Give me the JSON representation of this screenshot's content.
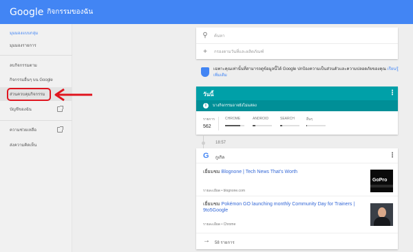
{
  "app": {
    "logo": "Google",
    "title": "กิจกรรมของฉัน"
  },
  "sidebar": {
    "items": [
      {
        "label": "มุมมองแบบกลุ่ม"
      },
      {
        "label": "มุมมองรายการ"
      },
      {
        "label": "ลบกิจกรรมตาม"
      },
      {
        "label": "กิจกรรมอื่นๆ บน Google"
      },
      {
        "label": "ส่วนควบคุมกิจกรรม"
      },
      {
        "label": "บัญชีของฉัน"
      },
      {
        "label": "ความช่วยเหลือ"
      },
      {
        "label": "ส่งความคิดเห็น"
      }
    ]
  },
  "search": {
    "placeholder": "ค้นหา",
    "filter_label": "กรองตามวันที่และผลิตภัณฑ์"
  },
  "privacy": {
    "text": "เฉพาะคุณเท่านั้นที่สามารถดูข้อมูลนี้ได้ Google ปกป้องความเป็นส่วนตัวและความปลอดภัยของคุณ",
    "link": "เรียนรู้เพิ่มเติม"
  },
  "today": {
    "title": "วันนี้",
    "notice": "บางกิจกรรมอาจยังไม่แสดง",
    "total_label": "รายการ",
    "total_value": "562",
    "stats": [
      {
        "label": "CHROME",
        "fill": 0.8
      },
      {
        "label": "ANDROID",
        "fill": 0.15
      },
      {
        "label": "SEARCH",
        "fill": 0.1
      },
      {
        "label": "อื่นๆ",
        "fill": 0.05
      }
    ]
  },
  "timeline": {
    "time": "18:57"
  },
  "google_card": {
    "name": "กูเกิล",
    "items": [
      {
        "prefix": "เยี่ยมชม",
        "title": "Blognone | Tech News That's Worth",
        "meta": "รายละเอียด • blognone.com",
        "thumb": "GoPro"
      },
      {
        "prefix": "เยี่ยมชม",
        "title": "Pokémon GO launching monthly Community Day for Trainers | 9to5Google",
        "meta": "รายละเอียด • Chrome",
        "thumb": "person-photo"
      }
    ],
    "more": "58 รายการ"
  }
}
